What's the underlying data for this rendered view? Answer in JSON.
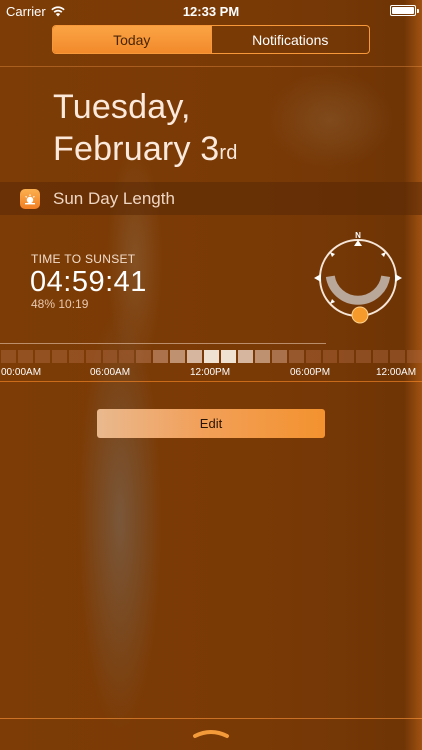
{
  "status_bar": {
    "carrier": "Carrier",
    "time": "12:33 PM",
    "wifi_icon": "wifi-icon",
    "battery_icon": "battery-icon"
  },
  "tabs": [
    {
      "label": "Today",
      "selected": true
    },
    {
      "label": "Notifications",
      "selected": false
    }
  ],
  "date": {
    "line1": "Tuesday,",
    "line2": "February 3",
    "ordinal": "rd"
  },
  "widget": {
    "title": "Sun Day Length",
    "icon": "sun-app-icon",
    "time_label": "TIME TO SUNSET",
    "countdown": "04:59:41",
    "percent": "48%",
    "day_length": "10:19",
    "compass_north": "N",
    "day_progress_fraction": 0.48
  },
  "hour_axis": [
    "00:00AM",
    "06:00AM",
    "12:00PM",
    "06:00PM",
    "12:00AM"
  ],
  "edit_label": "Edit",
  "colors": {
    "accent": "#f28a2b",
    "background": "#7b3b06",
    "sun": "#f59a2b"
  }
}
